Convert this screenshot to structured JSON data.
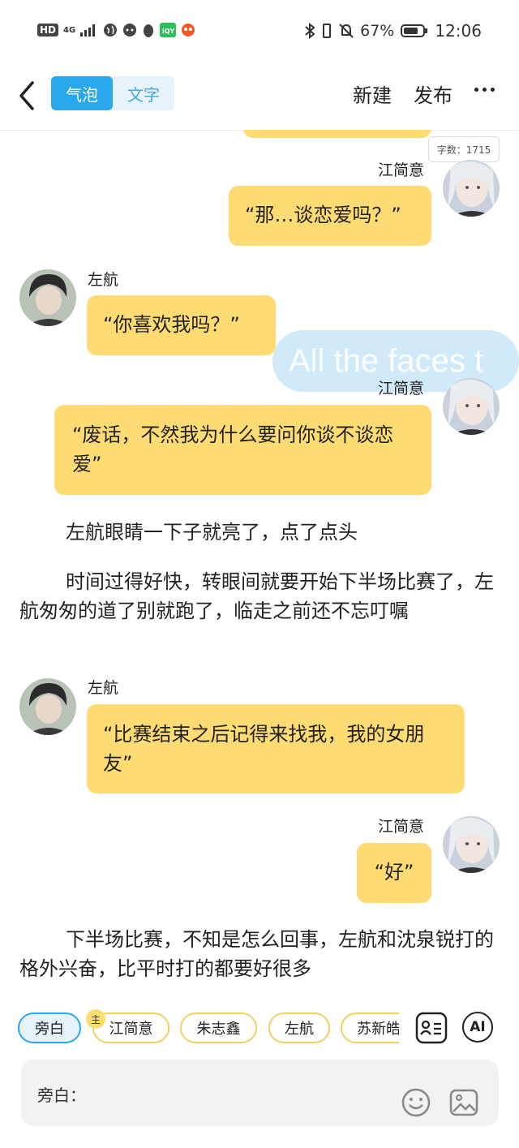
{
  "status_bar": {
    "network": "HD",
    "signal": "4G",
    "battery": "67%",
    "time": "12:06"
  },
  "topbar": {
    "tab_bubble": "气泡",
    "tab_text": "文字",
    "new_label": "新建",
    "publish_label": "发布"
  },
  "word_count": "字数：1715",
  "watermark_text": "All the faces t",
  "messages": {
    "m1_name": "江简意",
    "m1_text": "“那…谈恋爱吗？”",
    "m2_name": "左航",
    "m2_text": "“你喜欢我吗？”",
    "m3_name": "江简意",
    "m3_text": "“废话，不然我为什么要问你谈不谈恋爱”",
    "narr1": "左航眼睛一下子就亮了，点了点头",
    "narr2": "时间过得好快，转眼间就要开始下半场比赛了，左航匆匆的道了别就跑了，临走之前还不忘叮嘱",
    "m4_name": "左航",
    "m4_text": "“比赛结束之后记得来找我，我的女朋友”",
    "m5_name": "江简意",
    "m5_text": "“好”",
    "narr3": "下半场比赛，不知是怎么回事，左航和沈泉锐打的格外兴奋，比平时打的都要好很多"
  },
  "characters": {
    "narrator": "旁白",
    "host_badge": "主",
    "c1": "江简意",
    "c2": "朱志鑫",
    "c3": "左航",
    "c4": "苏新皓"
  },
  "input": {
    "label": "旁白："
  },
  "icons": {
    "ai_label": "AI"
  },
  "colors": {
    "accent": "#2aa8ee",
    "bubble": "#fedc73"
  }
}
